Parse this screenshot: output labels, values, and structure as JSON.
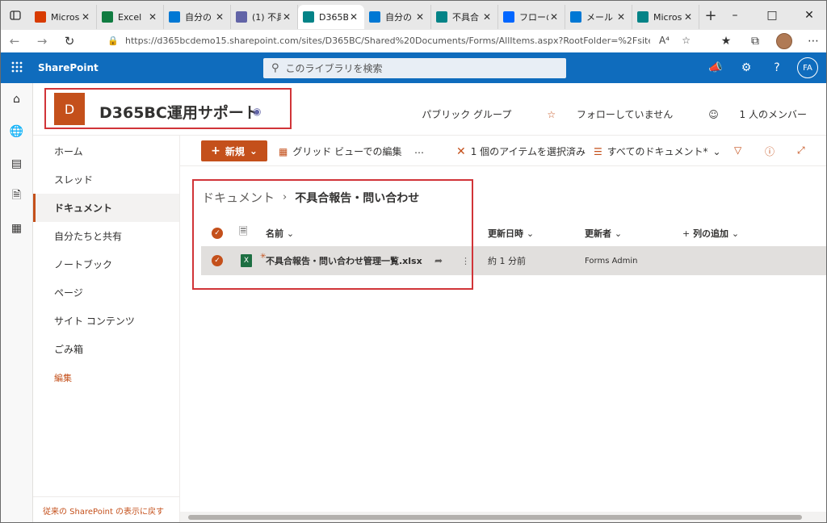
{
  "browser": {
    "tabs": [
      {
        "title": "Micros",
        "color": "#d83b01",
        "active": false
      },
      {
        "title": "Excel",
        "color": "#107c41",
        "active": false
      },
      {
        "title": "自分の",
        "color": "#0078d4",
        "active": false
      },
      {
        "title": "(1) 不具",
        "color": "#6264a7",
        "active": false
      },
      {
        "title": "D365B",
        "color": "#038387",
        "active": true
      },
      {
        "title": "自分の",
        "color": "#0078d4",
        "active": false
      },
      {
        "title": "不具合",
        "color": "#038387",
        "active": false
      },
      {
        "title": "フローの",
        "color": "#0066ff",
        "active": false
      },
      {
        "title": "メール -",
        "color": "#0078d4",
        "active": false
      },
      {
        "title": "Micros",
        "color": "#038387",
        "active": false
      }
    ],
    "url": "https://d365bcdemo15.sharepoint.com/sites/D365BC/Shared%20Documents/Forms/AllItems.aspx?RootFolder=%2Fsites%2FD365...",
    "url_suffix_btn": "A⁴"
  },
  "suitebar": {
    "app_name": "SharePoint",
    "search_placeholder": "このライブラリを検索",
    "avatar_initials": "FA"
  },
  "site": {
    "logo_letter": "D",
    "title": "D365BC運用サポート",
    "group_type": "パブリック グループ",
    "follow": "フォローしていません",
    "members": "1 人のメンバー"
  },
  "leftnav": {
    "items": [
      {
        "label": "ホーム"
      },
      {
        "label": "スレッド"
      },
      {
        "label": "ドキュメント"
      },
      {
        "label": "自分たちと共有"
      },
      {
        "label": "ノートブック"
      },
      {
        "label": "ページ"
      },
      {
        "label": "サイト コンテンツ"
      },
      {
        "label": "ごみ箱"
      },
      {
        "label": "編集"
      }
    ],
    "footer": "従来の SharePoint の表示に戻す"
  },
  "commandbar": {
    "new": "新規",
    "grid_edit": "グリッド ビューでの編集",
    "more": "…",
    "selected": "1 個のアイテムを選択済み",
    "view": "すべてのドキュメント*"
  },
  "breadcrumb": {
    "root": "ドキュメント",
    "current": "不具合報告・問い合わせ"
  },
  "list": {
    "columns": {
      "name": "名前",
      "modified": "更新日時",
      "modified_by": "更新者",
      "add_column": "列の追加"
    },
    "rows": [
      {
        "name": "不具合報告・問い合わせ管理一覧.xlsx",
        "modified": "約 1 分前",
        "modified_by": "Forms Admin"
      }
    ]
  },
  "colors": {
    "accent": "#c4501b",
    "suitebar": "#0f6cbd",
    "highlight": "#d13438"
  }
}
